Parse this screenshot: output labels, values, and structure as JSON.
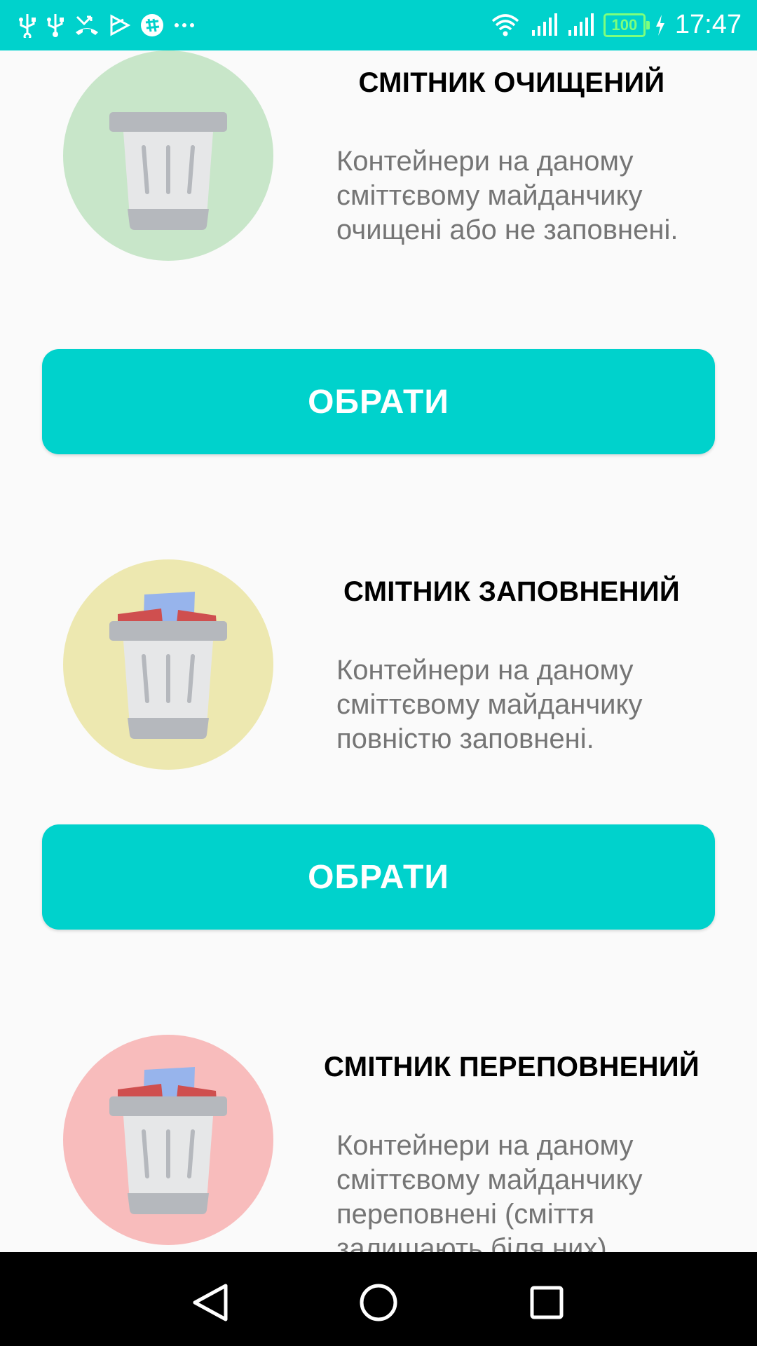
{
  "status_bar": {
    "time": "17:47",
    "battery": "100",
    "left_icons": [
      "usb-icon",
      "usb-icon",
      "missed-call-icon",
      "play-store-icon",
      "slack-icon",
      "more-icon"
    ],
    "right_icons": [
      "wifi-icon",
      "signal-icon",
      "signal-icon",
      "battery-icon",
      "charging-icon"
    ]
  },
  "cards": [
    {
      "title": "СМІТНИК ОЧИЩЕНИЙ",
      "description": "Контейнери на даному сміттєвому майданчику очищені або не заповнені.",
      "button_label": "ОБРАТИ",
      "circle_color": "#c8e6c9",
      "icon": "empty-trash-bin-icon"
    },
    {
      "title": "СМІТНИК ЗАПОВНЕНИЙ",
      "description": "Контейнери на даному сміттєвому майданчику повністю заповнені.",
      "button_label": "ОБРАТИ",
      "circle_color": "#ede8b0",
      "icon": "full-trash-bin-icon"
    },
    {
      "title": "СМІТНИК ПЕРЕПОВНЕНИЙ",
      "description": "Контейнери на даному сміттєвому майданчику переповнені (сміття залишають біля них).",
      "circle_color": "#f8bcbc",
      "icon": "overflowing-trash-bin-icon"
    }
  ],
  "colors": {
    "accent": "#00d2cc",
    "trash_lid": "#b5b8bd",
    "trash_body": "#e6e7e8",
    "paper_red": "#cf4f4f",
    "paper_blue": "#97b4ec"
  },
  "nav_bar": {
    "icons": [
      "back-icon",
      "home-icon",
      "recents-icon"
    ]
  }
}
